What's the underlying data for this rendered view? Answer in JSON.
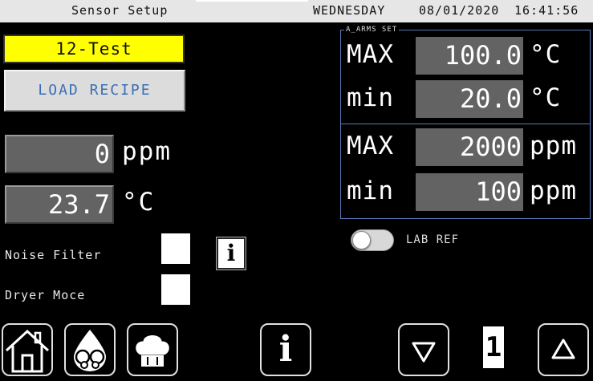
{
  "statusbar": {
    "title": "Sensor Setup",
    "day": "WEDNESDAY",
    "date": "08/01/2020",
    "time": "16:41:56"
  },
  "recipe": {
    "name": "12-Test",
    "load_label": "LOAD RECIPE",
    "highlight_color": "#ffff00"
  },
  "readings": {
    "ppm_value": "0",
    "ppm_unit": "ppm",
    "temp_value": "23.7",
    "temp_unit": "°C"
  },
  "options": {
    "noise_filter_label": "Noise Filter",
    "noise_filter_checked": false,
    "dryer_mode_label": "Dryer Moce",
    "dryer_mode_checked": false,
    "info_label": "i"
  },
  "alarms": {
    "legend": "A_ARMS SET",
    "temp_max_label": "MAX",
    "temp_max_value": "100.0",
    "temp_max_unit": "°C",
    "temp_min_label": "min",
    "temp_min_value": "20.0",
    "temp_min_unit": "°C",
    "ppm_max_label": "MAX",
    "ppm_max_value": "2000",
    "ppm_max_unit": "ppm",
    "ppm_min_label": "min",
    "ppm_min_value": "100",
    "ppm_min_unit": "ppm",
    "border_color": "#5b79b8"
  },
  "lab_ref": {
    "label": "LAB REF",
    "enabled": false
  },
  "bottom_nav": {
    "home_icon": "home-icon",
    "sensor_icon": "drop-glasses-icon",
    "recipe_icon": "chef-hat-icon",
    "info_label": "i",
    "down_icon": "triangle-down-icon",
    "page_number": "1",
    "up_icon": "triangle-up-icon"
  }
}
